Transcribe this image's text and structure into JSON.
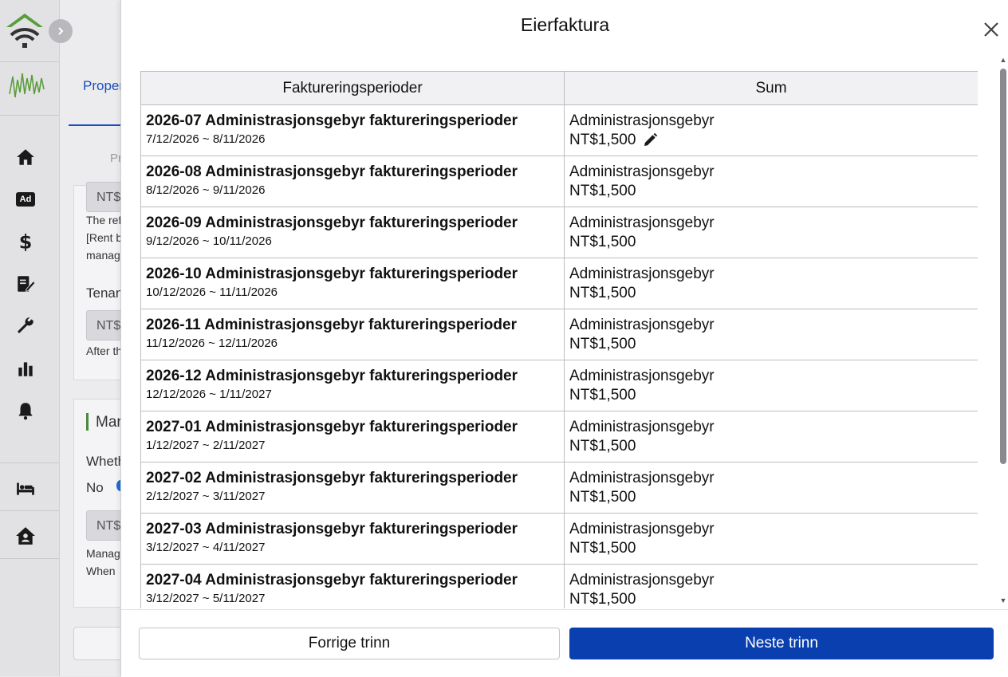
{
  "background": {
    "tab_label": "Proper",
    "crumb": "Pr",
    "input_prefix": "NT$",
    "rent_text_1": "The ref",
    "rent_text_2": "[Rent b",
    "rent_text_3": "manag",
    "tenant_label": "Tenan",
    "after_text": "After th",
    "section_title": "Mar",
    "whether_label": "Wheth",
    "no_label": "No",
    "manag_text": "Manag",
    "when_text": "When"
  },
  "modal": {
    "title": "Eierfaktura",
    "columns": [
      "Faktureringsperioder",
      "Sum"
    ],
    "rows": [
      {
        "period": "2026-07 Administrasjonsgebyr faktureringsperioder",
        "range": "7/12/2026 ~ 8/11/2026",
        "sum_label": "Administrasjonsgebyr",
        "sum_value": "NT$1,500"
      },
      {
        "period": "2026-08 Administrasjonsgebyr faktureringsperioder",
        "range": "8/12/2026 ~ 9/11/2026",
        "sum_label": "Administrasjonsgebyr",
        "sum_value": "NT$1,500"
      },
      {
        "period": "2026-09 Administrasjonsgebyr faktureringsperioder",
        "range": "9/12/2026 ~ 10/11/2026",
        "sum_label": "Administrasjonsgebyr",
        "sum_value": "NT$1,500"
      },
      {
        "period": "2026-10 Administrasjonsgebyr faktureringsperioder",
        "range": "10/12/2026 ~ 11/11/2026",
        "sum_label": "Administrasjonsgebyr",
        "sum_value": "NT$1,500"
      },
      {
        "period": "2026-11 Administrasjonsgebyr faktureringsperioder",
        "range": "11/12/2026 ~ 12/11/2026",
        "sum_label": "Administrasjonsgebyr",
        "sum_value": "NT$1,500"
      },
      {
        "period": "2026-12 Administrasjonsgebyr faktureringsperioder",
        "range": "12/12/2026 ~ 1/11/2027",
        "sum_label": "Administrasjonsgebyr",
        "sum_value": "NT$1,500"
      },
      {
        "period": "2027-01 Administrasjonsgebyr faktureringsperioder",
        "range": "1/12/2027 ~ 2/11/2027",
        "sum_label": "Administrasjonsgebyr",
        "sum_value": "NT$1,500"
      },
      {
        "period": "2027-02 Administrasjonsgebyr faktureringsperioder",
        "range": "2/12/2027 ~ 3/11/2027",
        "sum_label": "Administrasjonsgebyr",
        "sum_value": "NT$1,500"
      },
      {
        "period": "2027-03 Administrasjonsgebyr faktureringsperioder",
        "range": "3/12/2027 ~ 4/11/2027",
        "sum_label": "Administrasjonsgebyr",
        "sum_value": "NT$1,500"
      },
      {
        "period": "2027-04 Administrasjonsgebyr faktureringsperioder",
        "range": "3/12/2027 ~ 5/11/2027",
        "sum_label": "Administrasjonsgebyr",
        "sum_value": "NT$1,500"
      }
    ],
    "prev_label": "Forrige trinn",
    "next_label": "Neste trinn"
  },
  "colors": {
    "primary": "#0a3fb0",
    "link": "#1b4fbf",
    "logo_green": "#5a9e3a"
  },
  "icons": {
    "rail": [
      "wifi-home-logo-icon",
      "chevron-right-icon",
      "home-icon",
      "ad-icon",
      "dollar-icon",
      "edit-document-icon",
      "wrench-icon",
      "bar-chart-icon",
      "bell-icon",
      "bed-icon",
      "house-user-icon"
    ],
    "modal": [
      "close-icon",
      "pencil-icon"
    ]
  }
}
